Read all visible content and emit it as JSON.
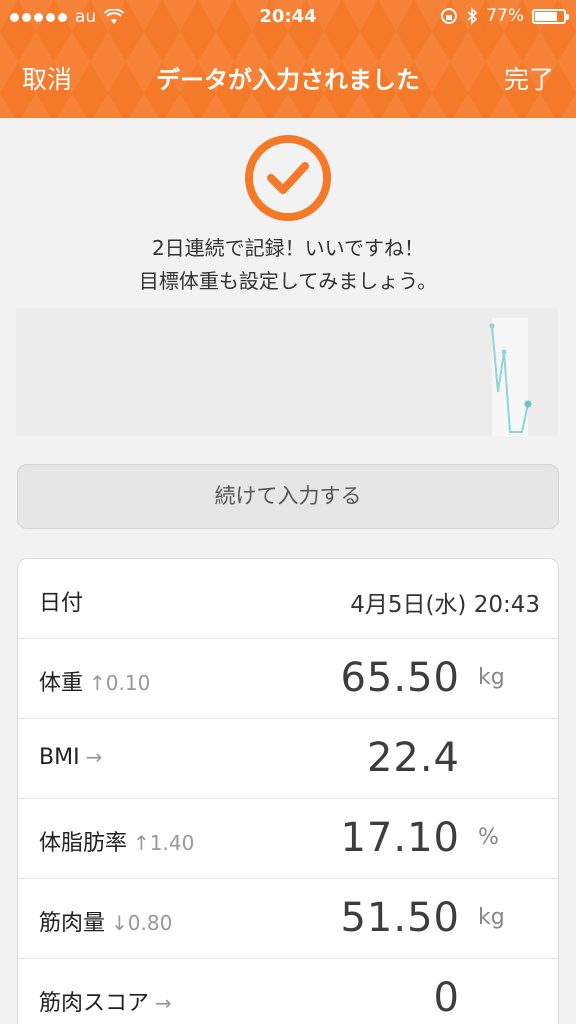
{
  "status": {
    "carrier": "au",
    "time": "20:44",
    "battery_text": "77%",
    "battery_level": 0.77
  },
  "nav": {
    "cancel": "取消",
    "title": "データが入力されました",
    "done": "完了"
  },
  "message": {
    "line1": "2日連続で記録！いいですね！",
    "line2": "目標体重も設定してみましょう。"
  },
  "continue_button": "続けて入力する",
  "rows": {
    "date": {
      "label": "日付",
      "value": "4月5日(水) 20:43"
    },
    "weight": {
      "label": "体重",
      "delta": "↑0.10",
      "value": "65.50",
      "unit": "kg"
    },
    "bmi": {
      "label": "BMI",
      "delta": "→",
      "value": "22.4",
      "unit": ""
    },
    "bodyfat": {
      "label": "体脂肪率",
      "delta": "↑1.40",
      "value": "17.10",
      "unit": "%"
    },
    "muscle": {
      "label": "筋肉量",
      "delta": "↓0.80",
      "value": "51.50",
      "unit": "kg"
    },
    "muscle_score": {
      "label": "筋肉スコア",
      "delta": "→",
      "value": "0",
      "unit": ""
    }
  },
  "colors": {
    "accent": "#f47a2a",
    "chart_line": "#7fcfcf"
  }
}
